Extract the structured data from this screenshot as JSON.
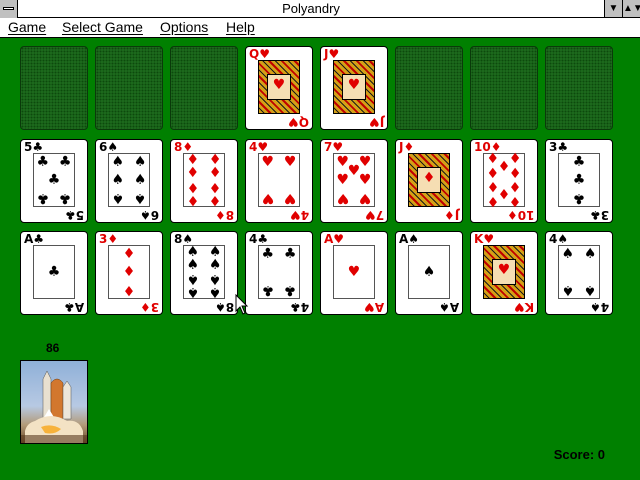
{
  "window": {
    "title": "Polyandry"
  },
  "menu": {
    "items": [
      "Game",
      "Select Game",
      "Options",
      "Help"
    ]
  },
  "row1": [
    {
      "slot": "empty"
    },
    {
      "slot": "empty"
    },
    {
      "slot": "empty"
    },
    {
      "rank": "Q",
      "suit": "♥",
      "color": "red",
      "face": true
    },
    {
      "rank": "J",
      "suit": "♥",
      "color": "red",
      "face": true
    },
    {
      "slot": "empty"
    },
    {
      "slot": "empty"
    },
    {
      "slot": "empty"
    }
  ],
  "row2": [
    {
      "rank": "5",
      "suit": "♣",
      "color": "black"
    },
    {
      "rank": "6",
      "suit": "♠",
      "color": "black"
    },
    {
      "rank": "8",
      "suit": "♦",
      "color": "red"
    },
    {
      "rank": "4",
      "suit": "♥",
      "color": "red"
    },
    {
      "rank": "7",
      "suit": "♥",
      "color": "red"
    },
    {
      "rank": "J",
      "suit": "♦",
      "color": "red",
      "face": true
    },
    {
      "rank": "10",
      "suit": "♦",
      "color": "red"
    },
    {
      "rank": "3",
      "suit": "♣",
      "color": "black"
    }
  ],
  "row3": [
    {
      "rank": "A",
      "suit": "♣",
      "color": "black"
    },
    {
      "rank": "3",
      "suit": "♦",
      "color": "red"
    },
    {
      "rank": "8",
      "suit": "♠",
      "color": "black"
    },
    {
      "rank": "4",
      "suit": "♣",
      "color": "black"
    },
    {
      "rank": "A",
      "suit": "♥",
      "color": "red"
    },
    {
      "rank": "A",
      "suit": "♠",
      "color": "black"
    },
    {
      "rank": "K",
      "suit": "♥",
      "color": "red",
      "face": true
    },
    {
      "rank": "4",
      "suit": "♠",
      "color": "black"
    }
  ],
  "stock": {
    "count": "86",
    "image": "space-shuttle-launch"
  },
  "status": {
    "score": "Score: 0"
  },
  "colors": {
    "table": "#008000",
    "red_suit": "#e00000",
    "black_suit": "#000000"
  }
}
